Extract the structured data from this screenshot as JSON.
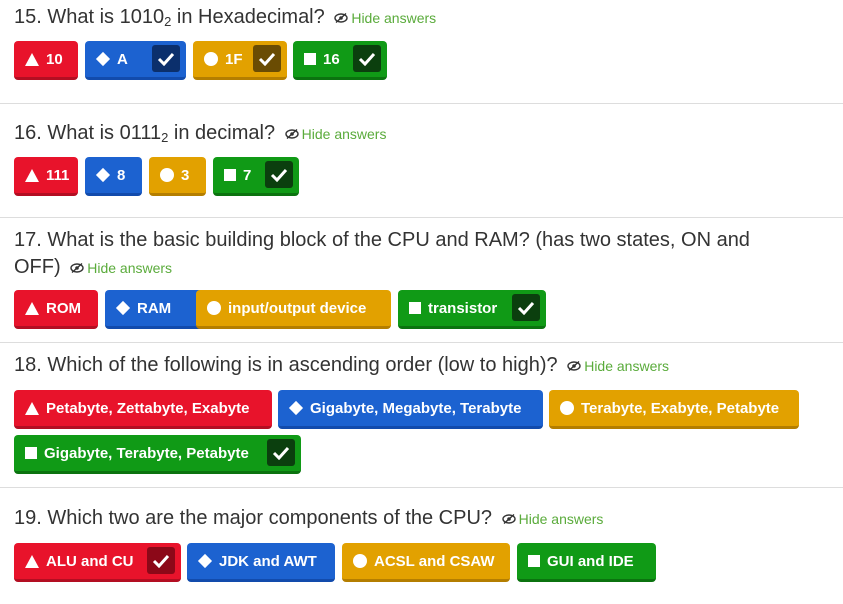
{
  "hide_label": "Hide answers",
  "questions": [
    {
      "num": "15.",
      "text_before": "What is 1010",
      "sub": "2",
      "text_after": " in Hexadecimal?",
      "answers": [
        {
          "label": "10",
          "shape": "triangle-icon",
          "color": "red",
          "correct": false
        },
        {
          "label": "A",
          "shape": "diamond-icon",
          "color": "blue",
          "correct": true
        },
        {
          "label": "1F",
          "shape": "circle-icon",
          "color": "yellow",
          "correct": true
        },
        {
          "label": "16",
          "shape": "square-icon",
          "color": "green",
          "correct": true
        }
      ]
    },
    {
      "num": "16.",
      "text_before": "What is 0111",
      "sub": "2",
      "text_after": " in decimal?",
      "answers": [
        {
          "label": "111",
          "shape": "triangle-icon",
          "color": "red",
          "correct": false
        },
        {
          "label": "8",
          "shape": "diamond-icon",
          "color": "blue",
          "correct": false
        },
        {
          "label": "3",
          "shape": "circle-icon",
          "color": "yellow",
          "correct": false
        },
        {
          "label": "7",
          "shape": "square-icon",
          "color": "green",
          "correct": true
        }
      ]
    },
    {
      "num": "17.",
      "text_line1": "What is the basic building block of the CPU and RAM? (has two states, ON and",
      "text_line2": "OFF)",
      "answers": [
        {
          "label": "ROM",
          "shape": "triangle-icon",
          "color": "red",
          "correct": false
        },
        {
          "label": "RAM",
          "shape": "diamond-icon",
          "color": "blue",
          "correct": false
        },
        {
          "label": "input/output device",
          "shape": "circle-icon",
          "color": "yellow",
          "correct": false
        },
        {
          "label": "transistor",
          "shape": "square-icon",
          "color": "green",
          "correct": true
        }
      ]
    },
    {
      "num": "18.",
      "text": "Which of the following is in ascending order (low to high)?",
      "answers": [
        {
          "label": "Petabyte, Zettabyte, Exabyte",
          "shape": "triangle-icon",
          "color": "red",
          "correct": false
        },
        {
          "label": "Gigabyte, Megabyte, Terabyte",
          "shape": "diamond-icon",
          "color": "blue",
          "correct": false
        },
        {
          "label": "Terabyte, Exabyte, Petabyte",
          "shape": "circle-icon",
          "color": "yellow",
          "correct": false
        },
        {
          "label": "Gigabyte, Terabyte, Petabyte",
          "shape": "square-icon",
          "color": "green",
          "correct": true
        }
      ]
    },
    {
      "num": "19.",
      "text": "Which two are the major components of the CPU?",
      "answers": [
        {
          "label": "ALU and CU",
          "shape": "triangle-icon",
          "color": "red",
          "correct": true
        },
        {
          "label": "JDK and AWT",
          "shape": "diamond-icon",
          "color": "blue",
          "correct": false
        },
        {
          "label": "ACSL and CSAW",
          "shape": "circle-icon",
          "color": "yellow",
          "correct": false
        },
        {
          "label": "GUI and IDE",
          "shape": "square-icon",
          "color": "green",
          "correct": false
        }
      ]
    }
  ],
  "colors": {
    "red": "#e8132b",
    "blue": "#1c62d0",
    "yellow": "#e2a100",
    "green": "#109a16",
    "link": "#5aab3b"
  }
}
